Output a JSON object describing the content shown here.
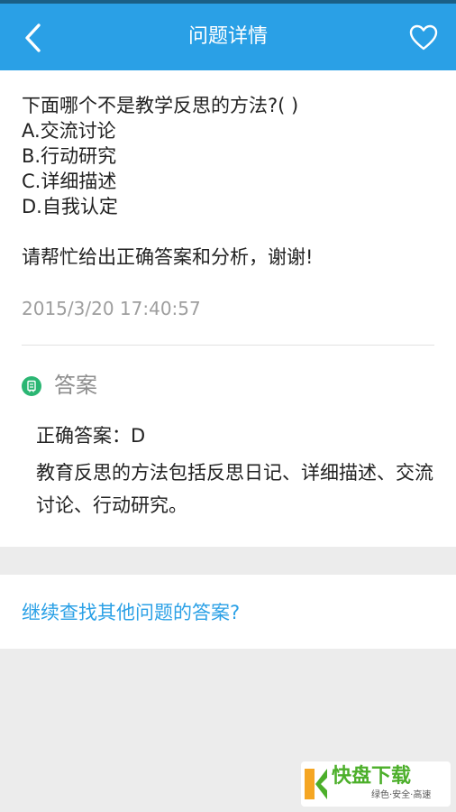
{
  "header": {
    "title": "问题详情",
    "back_icon": "chevron-left-icon",
    "favorite_icon": "heart-outline-icon",
    "bar_color": "#2aa0e6"
  },
  "question": {
    "prompt": "下面哪个不是教学反思的方法?(   )",
    "options": [
      "A.交流讨论",
      "B.行动研究",
      "C.详细描述",
      "D.自我认定"
    ],
    "request": "请帮忙给出正确答案和分析，谢谢!",
    "timestamp": "2015/3/20 17:40:57"
  },
  "answer": {
    "heading": "答案",
    "icon": "answer-badge-icon",
    "icon_color": "#2bb673",
    "correct": "正确答案：D",
    "analysis": "教育反思的方法包括反思日记、详细描述、交流讨论、行动研究。"
  },
  "more_link": {
    "label": "继续查找其他问题的答案?"
  },
  "watermark": {
    "brand": "快盘下载",
    "tagline": "绿色·安全·高速"
  }
}
